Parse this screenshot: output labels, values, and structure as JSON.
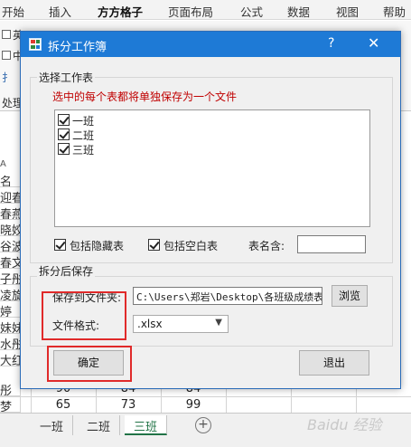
{
  "ribbon": {
    "tabs": [
      "开始",
      "插入",
      "方方格子",
      "页面布局",
      "公式",
      "数据",
      "视图",
      "帮助"
    ],
    "active_tab": "方方格子",
    "fragments": [
      "英",
      "中",
      "扌",
      "处理"
    ]
  },
  "sheet": {
    "col_header": "A",
    "row_cells": [
      "名",
      "迎春",
      "春燕",
      "晓姣",
      "谷波",
      "春文",
      "子彤",
      "凌旋",
      "婷",
      "妹妹",
      "水彤",
      "大红",
      "彤",
      "梦"
    ],
    "rows": [
      {
        "a": "彤",
        "b": "90",
        "c": "84",
        "d": "84"
      },
      {
        "a": "梦",
        "b": "65",
        "c": "73",
        "d": "99"
      }
    ]
  },
  "sheet_tabs": [
    "一班",
    "二班",
    "三班"
  ],
  "active_sheet": "三班",
  "add_sheet_symbol": "+",
  "watermark": "Baidu 经验",
  "dialog": {
    "title": "拆分工作簿",
    "help_symbol": "?",
    "close_symbol": "✕",
    "group_select_title": "选择工作表",
    "hint": "选中的每个表都将单独保存为一个文件",
    "sheets": [
      "一班",
      "二班",
      "三班"
    ],
    "include_hidden_label": "包括隐藏表",
    "include_blank_label": "包括空白表",
    "table_name_label": "表名含:",
    "table_name_value": "",
    "group_save_title": "拆分后保存",
    "save_folder_label": "保存到文件夹:",
    "save_folder_value": "C:\\Users\\郑岩\\Desktop\\各班级成绩表",
    "browse_label": "浏览",
    "format_label": "文件格式:",
    "format_value": ".xlsx",
    "ok_label": "确定",
    "exit_label": "退出"
  },
  "colors": {
    "titlebar": "#1e7ad6",
    "hint_text": "#c00000",
    "highlight_box": "#e02a2a",
    "excel_green": "#217346"
  },
  "icons": [
    "app-icon",
    "checkbox-checked-icon",
    "dropdown-arrow-icon",
    "add-sheet-icon"
  ]
}
